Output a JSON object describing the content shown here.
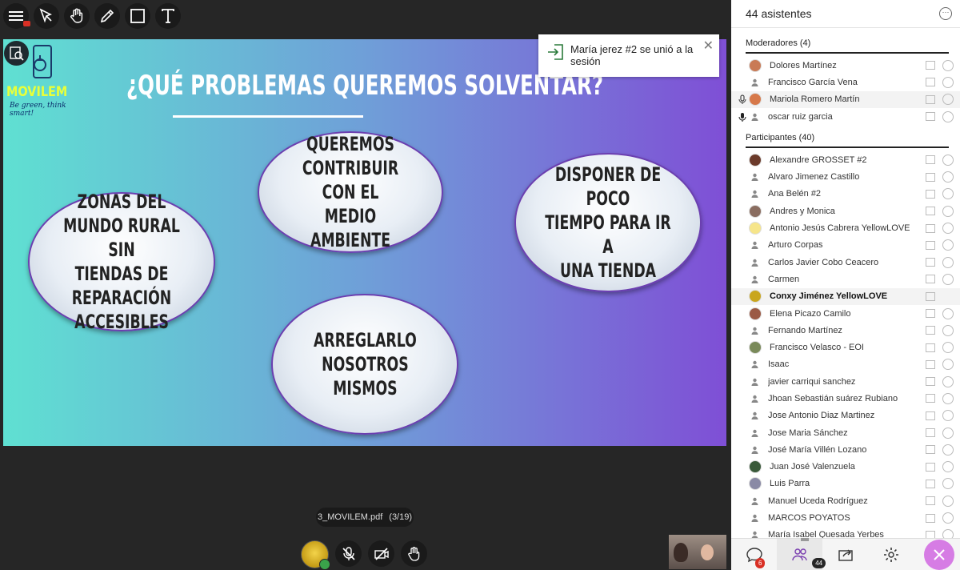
{
  "toolbar": {
    "tools": [
      "menu-icon",
      "pointer-icon",
      "pan-hand-icon",
      "pencil-icon",
      "rectangle-icon",
      "text-icon"
    ]
  },
  "slide": {
    "title": "¿QUÉ PROBLEMAS QUEREMOS SOLVENTAR?",
    "logo_name": "MOVILEM",
    "logo_slogan": "Be green, think smart!",
    "bubbles": [
      "ZONAS  DEL\nMUNDO RURAL SIN\nTIENDAS DE\nREPARACIÓN\nACCESIBLES",
      "QUEREMOS\nCONTRIBUIR CON EL\nMEDIO AMBIENTE",
      "DISPONER DE POCO\nTIEMPO PARA IR A\nUNA TIENDA",
      "ARREGLARLO\nNOSOTROS\nMISMOS"
    ]
  },
  "toast": {
    "text": "María jerez #2 se unió a la sesión"
  },
  "file": {
    "name": "3_MOVILEM.pdf",
    "page": "(3/19)"
  },
  "panel": {
    "title": "44 asistentes",
    "moderators_title": "Moderadores (4)",
    "moderators": [
      {
        "name": "Dolores Martínez",
        "mic": "",
        "avatar": "#c97a55"
      },
      {
        "name": "Francisco García Vena",
        "mic": "",
        "avatar": ""
      },
      {
        "name": "Mariola Romero Martín",
        "mic": "mic-outline",
        "avatar": "#d7794a"
      },
      {
        "name": "oscar ruiz garcia",
        "mic": "mic-filled",
        "avatar": ""
      }
    ],
    "participants_title": "Participantes (40)",
    "participants": [
      {
        "name": "Alexandre GROSSET #2",
        "avatar": "#6b3a2a",
        "bold": false
      },
      {
        "name": "Alvaro Jimenez Castillo",
        "avatar": "",
        "bold": false
      },
      {
        "name": "Ana Belén #2",
        "avatar": "",
        "bold": false
      },
      {
        "name": "Andres y Monica",
        "avatar": "#8a6d60",
        "bold": false
      },
      {
        "name": "Antonio Jesús Cabrera YellowLOVE",
        "avatar": "#f6e58a",
        "bold": false
      },
      {
        "name": "Arturo Corpas",
        "avatar": "",
        "bold": false
      },
      {
        "name": "Carlos Javier Cobo Ceacero",
        "avatar": "",
        "bold": false
      },
      {
        "name": "Carmen",
        "avatar": "",
        "bold": false
      },
      {
        "name": "Conxy Jiménez YellowLOVE",
        "avatar": "#c9a61e",
        "bold": true
      },
      {
        "name": "Elena Picazo Camilo",
        "avatar": "#9b5a45",
        "bold": false
      },
      {
        "name": "Fernando Martínez",
        "avatar": "",
        "bold": false
      },
      {
        "name": "Francisco Velasco - EOI",
        "avatar": "#7a8a5a",
        "bold": false
      },
      {
        "name": "Isaac",
        "avatar": "",
        "bold": false
      },
      {
        "name": "javier carriqui sanchez",
        "avatar": "",
        "bold": false
      },
      {
        "name": "Jhoan Sebastián suárez Rubiano",
        "avatar": "",
        "bold": false
      },
      {
        "name": "Jose Antonio Diaz Martinez",
        "avatar": "",
        "bold": false
      },
      {
        "name": "Jose Maria Sánchez",
        "avatar": "",
        "bold": false
      },
      {
        "name": "José María Villén Lozano",
        "avatar": "",
        "bold": false
      },
      {
        "name": "Juan José Valenzuela",
        "avatar": "#3a5a3a",
        "bold": false
      },
      {
        "name": "Luis Parra",
        "avatar": "#8a8aa5",
        "bold": false
      },
      {
        "name": "Manuel Uceda Rodríguez",
        "avatar": "",
        "bold": false
      },
      {
        "name": "MARCOS POYATOS",
        "avatar": "",
        "bold": false
      },
      {
        "name": "María Isabel Quesada Yerbes",
        "avatar": "",
        "bold": false
      }
    ],
    "footer": {
      "chat_badge": "6",
      "attendees_badge": "44"
    }
  }
}
